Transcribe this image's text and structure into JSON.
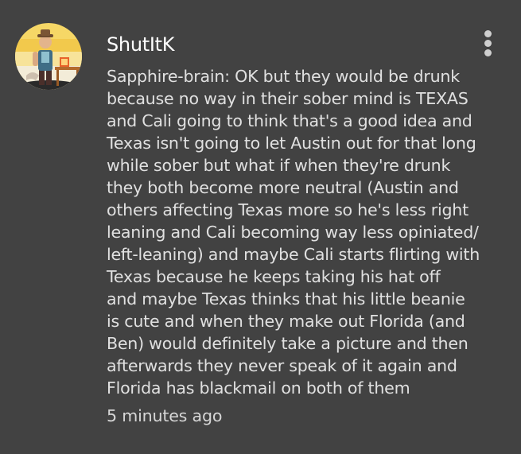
{
  "comment": {
    "username": "ShutItK",
    "avatar_icon": "character-avatar-icon",
    "more_icon": "more-vertical-icon",
    "body_lines": [
      "Sapphire-brain: OK but they would be drunk",
      "because no way in their sober mind is TEXAS",
      "and Cali going to think that's a good idea and",
      "Texas isn't going to let Austin out for that long",
      "while sober but what if when they're drunk",
      "they both become more neutral (Austin and",
      "others affecting Texas more so he's less right",
      "leaning and Cali becoming way less opiniated/",
      "left-leaning) and maybe Cali starts flirting with",
      "Texas because he keeps taking his hat off",
      "and maybe Texas thinks that his little beanie",
      "is cute and when they make out Florida (and",
      "Ben) would definitely take a picture and then",
      "afterwards they never speak of it again and",
      "Florida has blackmail on both of them"
    ],
    "timestamp": "5 minutes ago"
  },
  "colors": {
    "background": "#424242",
    "username": "#ffffff",
    "body_text": "#e0e0e0",
    "timestamp": "#d6d6d6",
    "avatar_yellow": "#f5cf5a"
  }
}
